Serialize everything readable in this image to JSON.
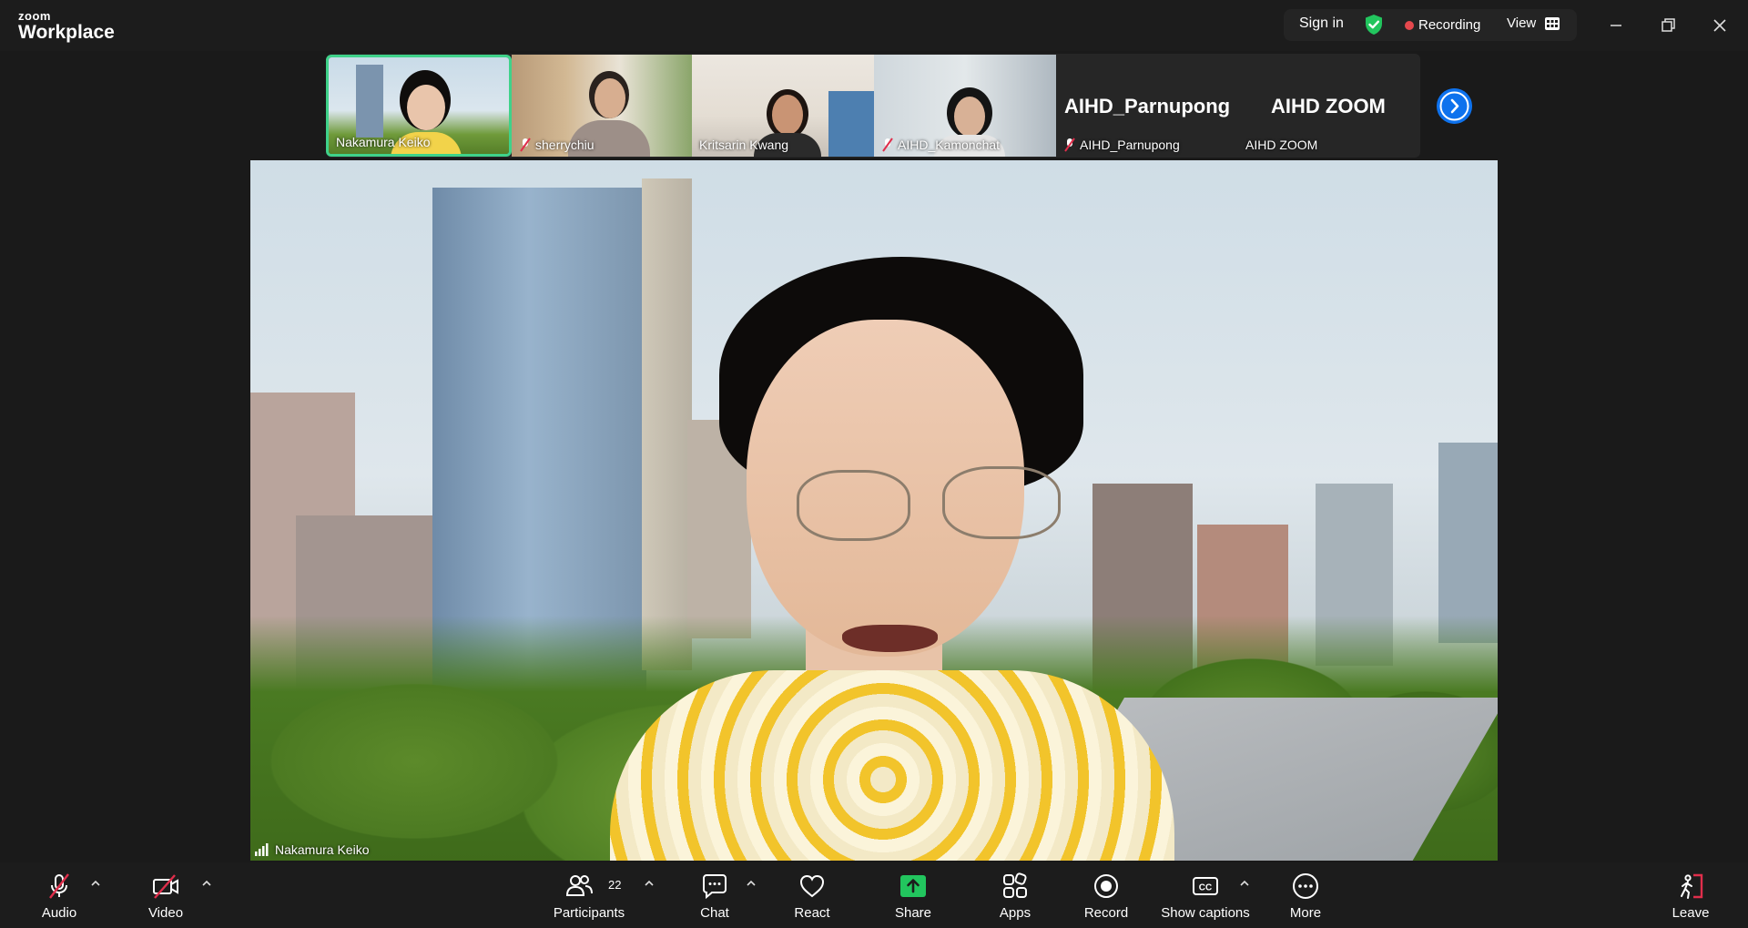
{
  "app": {
    "brand_small": "zoom",
    "brand_big": "Workplace"
  },
  "topbar": {
    "sign_in": "Sign in",
    "recording": "Recording",
    "view": "View"
  },
  "thumbnails": [
    {
      "name": "Nakamura Keiko",
      "muted": false,
      "active": true
    },
    {
      "name": "sherrychiu",
      "muted": true,
      "active": false
    },
    {
      "name": "Kritsarin Kwang",
      "muted": false,
      "active": false
    },
    {
      "name": "AIHD_Kamonchat",
      "muted": true,
      "active": false
    },
    {
      "name": "AIHD_Parnupong",
      "muted": true,
      "active": false,
      "display_name": "AIHD_Parnupong"
    },
    {
      "name": "AIHD ZOOM",
      "muted": false,
      "active": false,
      "display_name": "AIHD ZOOM"
    }
  ],
  "main_video": {
    "speaker_name": "Nakamura Keiko"
  },
  "toolbar": {
    "audio": "Audio",
    "video": "Video",
    "participants": "Participants",
    "participants_count": "22",
    "chat": "Chat",
    "react": "React",
    "share": "Share",
    "apps": "Apps",
    "record": "Record",
    "captions": "Show captions",
    "more": "More",
    "leave": "Leave"
  },
  "colors": {
    "accent_blue": "#0e72ed",
    "active_green": "#3fd28a",
    "share_green": "#22c55e",
    "recording_red": "#e5484d",
    "leave_red": "#e02e4b"
  }
}
